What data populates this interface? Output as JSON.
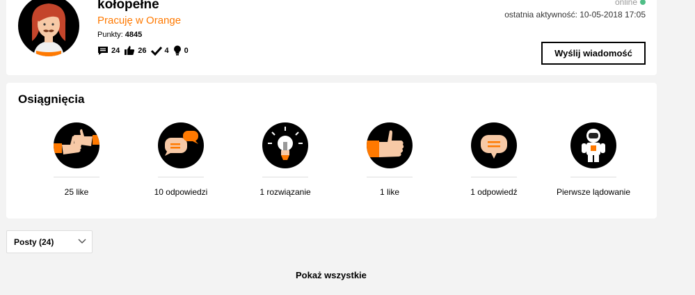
{
  "profile": {
    "username": "kołopełne",
    "company": "Pracuję w Orange",
    "points_label": "Punkty:",
    "points_value": "4845",
    "stats": {
      "comments": "24",
      "likes": "26",
      "solutions": "4",
      "ideas": "0"
    },
    "status_text": "online",
    "last_active": "ostatnia aktywność: 10-05-2018 17:05",
    "send_button": "Wyślij wiadomość"
  },
  "achievements": {
    "title": "Osiągnięcia",
    "badges": [
      {
        "label": "25 like",
        "icon": "two-thumbs-up-icon"
      },
      {
        "label": "10 odpowiedzi",
        "icon": "speech-bubbles-icon"
      },
      {
        "label": "1 rozwiązanie",
        "icon": "lightbulb-icon"
      },
      {
        "label": "1 like",
        "icon": "thumb-up-icon"
      },
      {
        "label": "1 odpowiedź",
        "icon": "speech-bubble-icon"
      },
      {
        "label": "Pierwsze lądowanie",
        "icon": "astronaut-icon"
      }
    ]
  },
  "posts_dropdown": {
    "selected": "Posty (24)"
  },
  "show_all": "Pokaż wszystkie",
  "colors": {
    "accent": "#ff7900",
    "online": "#50be87"
  }
}
